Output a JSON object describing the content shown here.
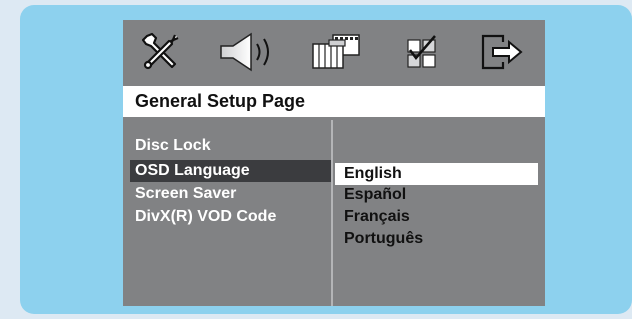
{
  "toolbar": {
    "icons": [
      {
        "name": "general-setup-tools-icon"
      },
      {
        "name": "audio-speaker-icon"
      },
      {
        "name": "video-film-icon"
      },
      {
        "name": "preference-checkbox-icon"
      },
      {
        "name": "exit-arrow-icon"
      }
    ]
  },
  "header": {
    "title": "General Setup Page"
  },
  "menu": {
    "items": [
      {
        "label": "Disc Lock"
      },
      {
        "label": "OSD Language"
      },
      {
        "label": "Screen Saver"
      },
      {
        "label": "DivX(R) VOD Code"
      }
    ],
    "selected_index": 1
  },
  "options": {
    "items": [
      {
        "label": "English"
      },
      {
        "label": "Español"
      },
      {
        "label": "Français"
      },
      {
        "label": "Português"
      }
    ],
    "selected_index": 0
  },
  "colors": {
    "backdrop": "#8dd1ee",
    "panel": "#818284",
    "menu_highlight": "#3b3c3f",
    "option_highlight": "#ffffff"
  }
}
